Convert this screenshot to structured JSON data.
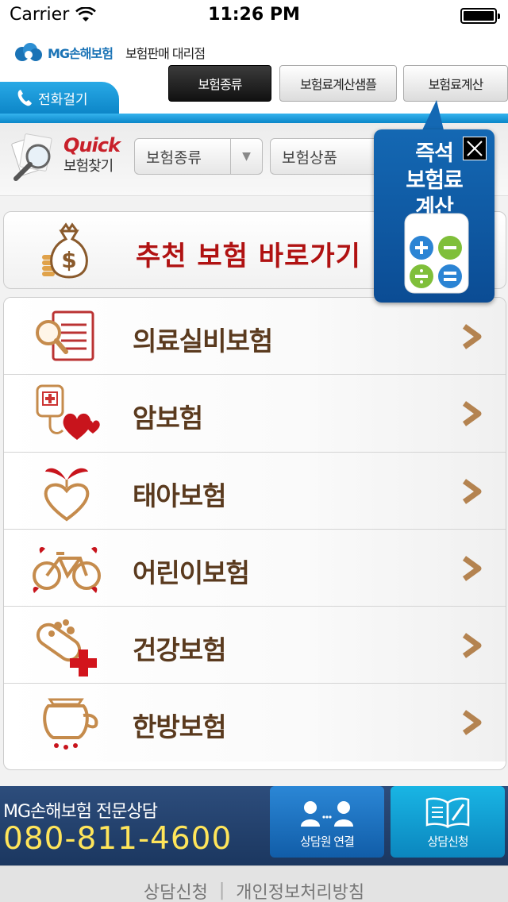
{
  "status_bar": {
    "carrier": "Carrier",
    "time": "11:26 PM"
  },
  "header": {
    "brand": "MG손해보험",
    "subtitle": "보험판매 대리점",
    "call_tab": "전화걸기",
    "buttons": {
      "insurance_type": "보험종류",
      "calc_sample": "보험료계산샘플",
      "calc": "보험료계산"
    },
    "colors": {
      "accent": "#0d86c8",
      "dark_button": "#111111"
    }
  },
  "quick": {
    "title": "Quick",
    "subtitle": "보험찾기",
    "type_select": "보험종류",
    "product_select": "보험상품"
  },
  "recommend": {
    "label": "추천 보험 바로가기"
  },
  "insurance_list": [
    {
      "label": "의료실비보험",
      "icon": "medical-document-icon"
    },
    {
      "label": "암보험",
      "icon": "iv-heart-icon"
    },
    {
      "label": "태아보험",
      "icon": "sprout-heart-icon"
    },
    {
      "label": "어린이보험",
      "icon": "bicycle-icon"
    },
    {
      "label": "건강보험",
      "icon": "pill-cross-icon"
    },
    {
      "label": "한방보험",
      "icon": "herbal-pot-icon"
    }
  ],
  "calc_popup": {
    "line1": "즉석",
    "line2": "보험료",
    "line3": "계산"
  },
  "bottom": {
    "consult_title": "MG손해보험 전문상담",
    "phone": "080-811-4600",
    "connect_button": "상담원 연결",
    "apply_button": "상담신청"
  },
  "footer": {
    "link1": "상담신청",
    "separator": "|",
    "link2": "개인정보처리방침"
  }
}
